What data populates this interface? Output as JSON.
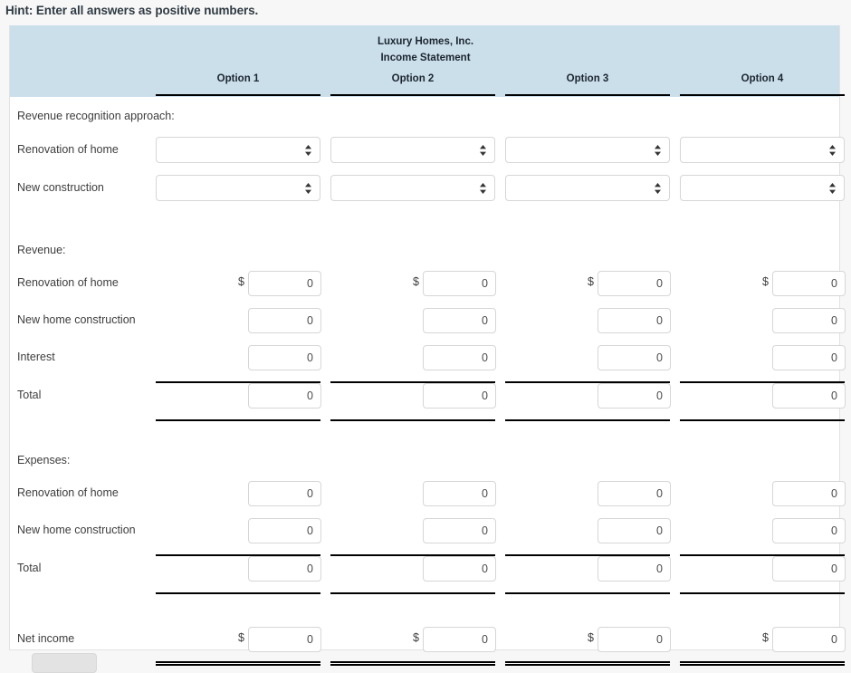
{
  "hint": {
    "text": "Hint: Enter all answers as positive numbers."
  },
  "table": {
    "entity_name": "Luxury Homes, Inc.",
    "statement_name": "Income Statement",
    "header_bg": "#cbdfeb",
    "columns": [
      {
        "label": "Option 1"
      },
      {
        "label": "Option 2"
      },
      {
        "label": "Option 3"
      },
      {
        "label": "Option 4"
      }
    ],
    "sections": [
      {
        "name": "revenue-recognition",
        "heading": "Revenue recognition approach:",
        "rows": [
          {
            "label": "Renovation of home",
            "control": "select",
            "values": [
              "",
              "",
              "",
              ""
            ],
            "currency": [
              false,
              false,
              false,
              false
            ]
          },
          {
            "label": "New construction",
            "control": "select",
            "values": [
              "",
              "",
              "",
              ""
            ],
            "currency": [
              false,
              false,
              false,
              false
            ]
          }
        ]
      },
      {
        "name": "revenue",
        "heading": "Revenue:",
        "rows": [
          {
            "label": "Renovation of home",
            "control": "input",
            "values": [
              "0",
              "0",
              "0",
              "0"
            ],
            "currency": [
              true,
              true,
              true,
              true
            ]
          },
          {
            "label": "New home construction",
            "control": "input",
            "values": [
              "0",
              "0",
              "0",
              "0"
            ],
            "currency": [
              false,
              false,
              false,
              false
            ]
          },
          {
            "label": "Interest",
            "control": "input",
            "values": [
              "0",
              "0",
              "0",
              "0"
            ],
            "currency": [
              false,
              false,
              false,
              false
            ],
            "rule_below": "single"
          },
          {
            "label": "Total",
            "control": "input",
            "values": [
              "0",
              "0",
              "0",
              "0"
            ],
            "currency": [
              false,
              false,
              false,
              false
            ],
            "rule_below": "single"
          }
        ]
      },
      {
        "name": "expenses",
        "heading": "Expenses:",
        "rows": [
          {
            "label": "Renovation of home",
            "control": "input",
            "values": [
              "0",
              "0",
              "0",
              "0"
            ],
            "currency": [
              false,
              false,
              false,
              false
            ]
          },
          {
            "label": "New home construction",
            "control": "input",
            "values": [
              "0",
              "0",
              "0",
              "0"
            ],
            "currency": [
              false,
              false,
              false,
              false
            ],
            "rule_below": "single"
          },
          {
            "label": "Total",
            "control": "input",
            "values": [
              "0",
              "0",
              "0",
              "0"
            ],
            "currency": [
              false,
              false,
              false,
              false
            ],
            "rule_below": "single"
          }
        ]
      },
      {
        "name": "net-income",
        "heading": "",
        "rows": [
          {
            "label": "Net income",
            "control": "input",
            "values": [
              "0",
              "0",
              "0",
              "0"
            ],
            "currency": [
              true,
              true,
              true,
              true
            ],
            "rule_below": "double"
          }
        ]
      }
    ],
    "currency_symbol": "$"
  },
  "footer": {
    "button_label": ""
  }
}
